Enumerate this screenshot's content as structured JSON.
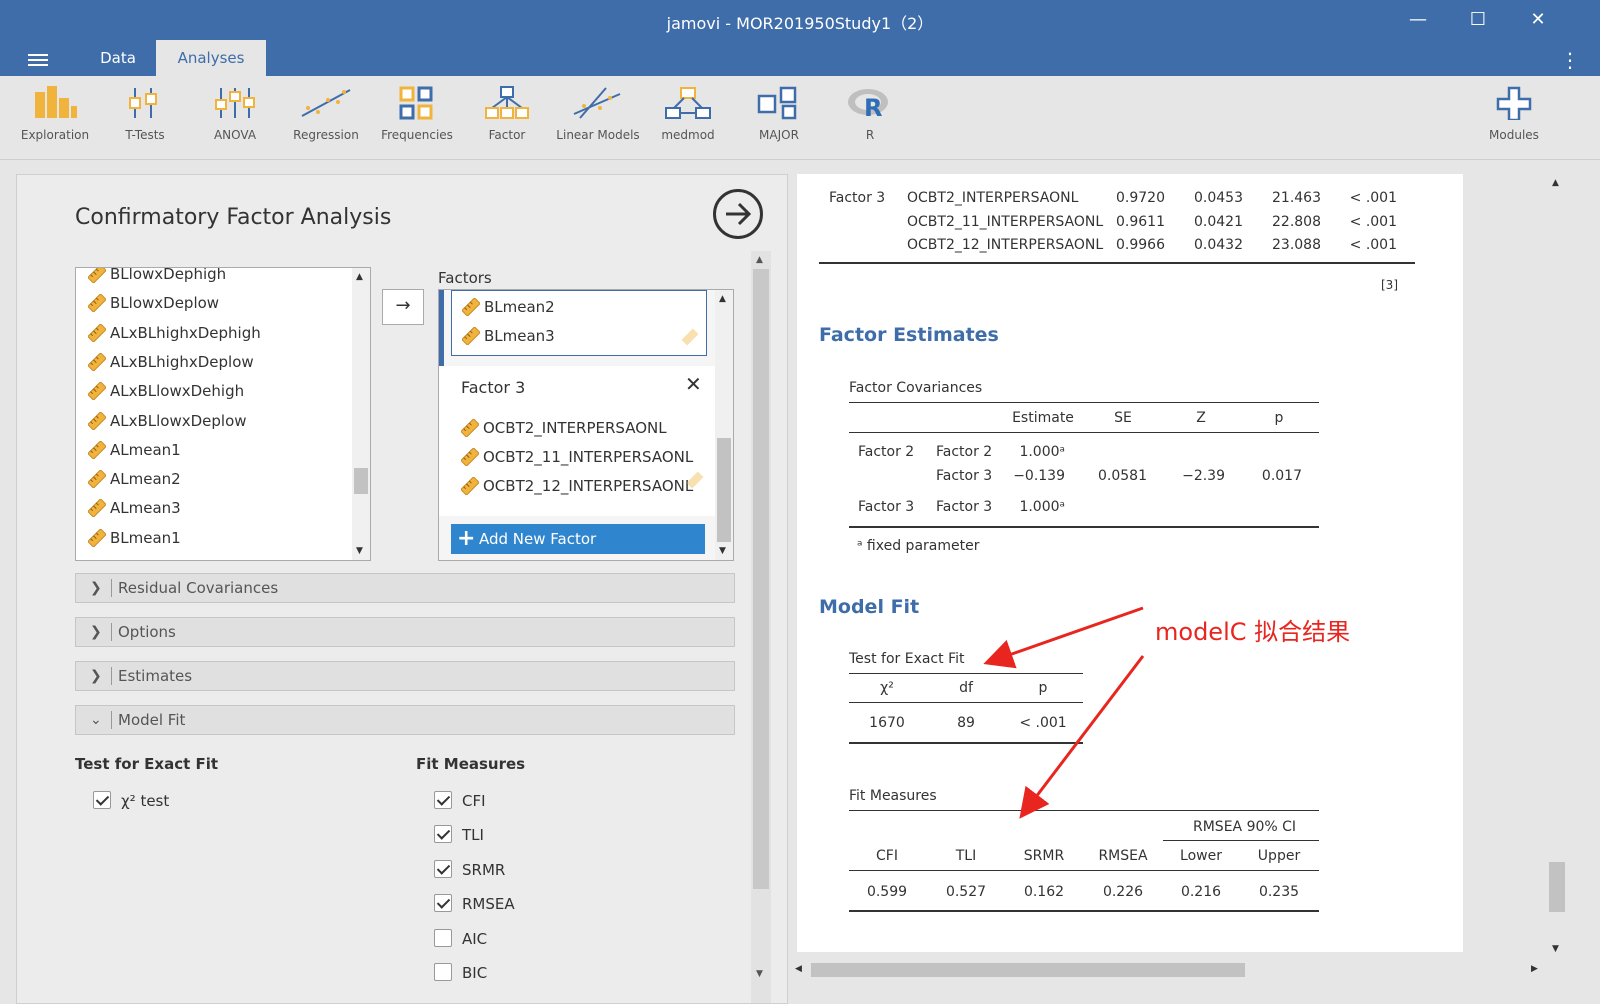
{
  "window": {
    "title": "jamovi - MOR201950Study1（2）"
  },
  "tabs": [
    "Data",
    "Analyses"
  ],
  "ribbon": [
    "Exploration",
    "T-Tests",
    "ANOVA",
    "Regression",
    "Frequencies",
    "Factor",
    "Linear Models",
    "medmod",
    "MAJOR",
    "R"
  ],
  "ribbon_right": "Modules",
  "left": {
    "title": "Confirmatory Factor Analysis",
    "variables": [
      "BLlowxDephigh",
      "BLlowxDeplow",
      "ALxBLhighxDephigh",
      "ALxBLhighxDeplow",
      "ALxBLlowxDehigh",
      "ALxBLlowxDeplow",
      "ALmean1",
      "ALmean2",
      "ALmean3",
      "BLmean1"
    ],
    "factors_label": "Factors",
    "factor2_items": [
      "BLmean2",
      "BLmean3"
    ],
    "factor3": {
      "name": "Factor 3",
      "items": [
        "OCBT2_INTERPERSAONL",
        "OCBT2_11_INTERPERSAONL",
        "OCBT2_12_INTERPERSAONL"
      ]
    },
    "add_factor": "Add New Factor",
    "sections": [
      "Residual Covariances",
      "Options",
      "Estimates",
      "Model Fit"
    ],
    "exact_fit_header": "Test for Exact Fit",
    "chi_test": "χ² test",
    "fit_measures_header": "Fit Measures",
    "fit_measures": [
      {
        "label": "CFI",
        "checked": true
      },
      {
        "label": "TLI",
        "checked": true
      },
      {
        "label": "SRMR",
        "checked": true
      },
      {
        "label": "RMSEA",
        "checked": true
      },
      {
        "label": "AIC",
        "checked": false
      },
      {
        "label": "BIC",
        "checked": false
      }
    ]
  },
  "right": {
    "loadings_factor": "Factor 3",
    "loadings": [
      {
        "item": "OCBT2_INTERPERSAONL",
        "est": "0.9720",
        "se": "0.0453",
        "z": "21.463",
        "p": "< .001"
      },
      {
        "item": "OCBT2_11_INTERPERSAONL",
        "est": "0.9611",
        "se": "0.0421",
        "z": "22.808",
        "p": "< .001"
      },
      {
        "item": "OCBT2_12_INTERPERSAONL",
        "est": "0.9966",
        "se": "0.0432",
        "z": "23.088",
        "p": "< .001"
      }
    ],
    "ref": "[3]",
    "factor_estimates_heading": "Factor Estimates",
    "factor_cov_title": "Factor Covariances",
    "cov_headers": [
      "Estimate",
      "SE",
      "Z",
      "p"
    ],
    "cov_rows": [
      {
        "f1": "Factor 2",
        "f2": "Factor 2",
        "est": "1.000ᵃ",
        "se": "",
        "z": "",
        "p": ""
      },
      {
        "f1": "",
        "f2": "Factor 3",
        "est": "−0.139",
        "se": "0.0581",
        "z": "−2.39",
        "p": "0.017"
      },
      {
        "f1": "Factor 3",
        "f2": "Factor 3",
        "est": "1.000ᵃ",
        "se": "",
        "z": "",
        "p": ""
      }
    ],
    "cov_note": "ᵃ fixed parameter",
    "model_fit_heading": "Model Fit",
    "exact_fit_title": "Test for Exact Fit",
    "exact_headers": [
      "χ²",
      "df",
      "p"
    ],
    "exact_values": [
      "1670",
      "89",
      "< .001"
    ],
    "fit_title": "Fit Measures",
    "rmsea_ci": "RMSEA 90% CI",
    "fit_headers": [
      "CFI",
      "TLI",
      "SRMR",
      "RMSEA",
      "Lower",
      "Upper"
    ],
    "fit_values": [
      "0.599",
      "0.527",
      "0.162",
      "0.226",
      "0.216",
      "0.235"
    ],
    "annotation": "modelC 拟合结果"
  },
  "colors": {
    "brand": "#3e6da9",
    "accent_button": "#2f86cf",
    "annotation": "#e8251f",
    "ruler": "#f0b33c"
  }
}
